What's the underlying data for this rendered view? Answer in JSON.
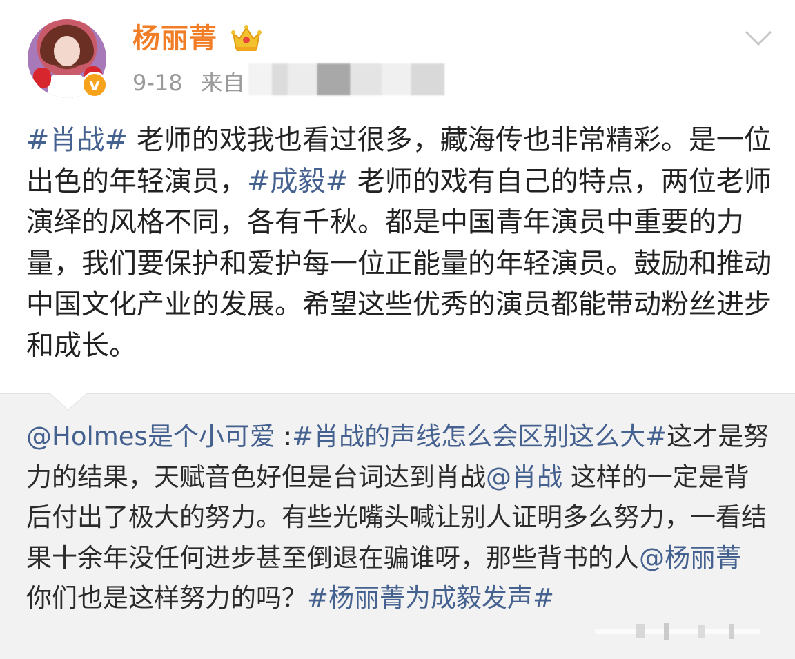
{
  "post": {
    "username": "杨丽菁",
    "time": "9-18",
    "source_prefix": "来自",
    "segments": [
      {
        "text": "#肖战#",
        "type": "tag"
      },
      {
        "text": " 老师的戏我也看过很多，藏海传也非常精彩。是一位出色的年轻演员，",
        "type": "text"
      },
      {
        "text": "#成毅#",
        "type": "tag"
      },
      {
        "text": " 老师的戏有自己的特点，两位老师演绎的风格不同，各有千秋。都是中国青年演员中重要的力量，我们要保护和爱护每一位正能量的年轻演员。鼓励和推动中国文化产业的发展。希望这些优秀的演员都能带动粉丝进步和成长。",
        "type": "text"
      }
    ]
  },
  "repost": {
    "segments": [
      {
        "text": "@Holmes是个小可爱",
        "type": "mention"
      },
      {
        "text": " :",
        "type": "text"
      },
      {
        "text": "#肖战的声线怎么会区别这么大#",
        "type": "tag"
      },
      {
        "text": "这才是努力的结果，天赋音色好但是台词达到肖战",
        "type": "text"
      },
      {
        "text": "@肖战",
        "type": "mention"
      },
      {
        "text": " 这样的一定是背后付出了极大的努力。有些光嘴头喊让别人证明多么努力，一看结果十余年没任何进步甚至倒退在骗谁呀，那些背书的人",
        "type": "text"
      },
      {
        "text": "@杨丽菁",
        "type": "mention"
      },
      {
        "text": " 你们也是这样努力的吗？",
        "type": "text"
      },
      {
        "text": "#杨丽菁为成毅发声#",
        "type": "tag"
      }
    ]
  },
  "icons": {
    "avatar": "avatar-image",
    "verified": "verified-v-icon",
    "crown": "crown-icon",
    "more": "chevron-down-icon",
    "watermark": "watermark-logo"
  },
  "colors": {
    "username": "#f17d26",
    "tag": "#45618f",
    "verified": "#f7a21b",
    "repost_bg": "#f2f2f2",
    "meta": "#9a9a9a"
  }
}
